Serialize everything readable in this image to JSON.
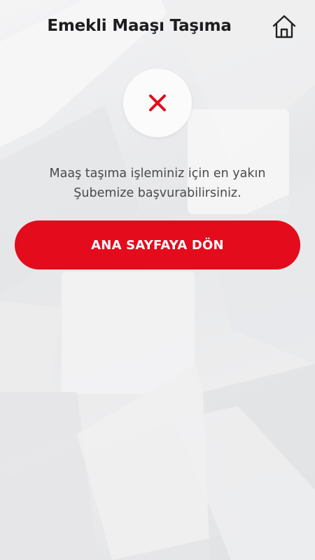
{
  "header": {
    "title": "Emekli Maaşı Taşıma"
  },
  "icons": {
    "home": "home-icon",
    "result": "close-icon"
  },
  "message": {
    "line1": "Maaş taşıma işleminiz için en yakın",
    "line2": "Şubemize başvurabilirsiniz."
  },
  "actions": {
    "home_button_label": "ANA SAYFAYA DÖN"
  },
  "colors": {
    "accent": "#e30b1c",
    "title_text": "#1d1d1f",
    "body_text": "#4a4a4d"
  }
}
